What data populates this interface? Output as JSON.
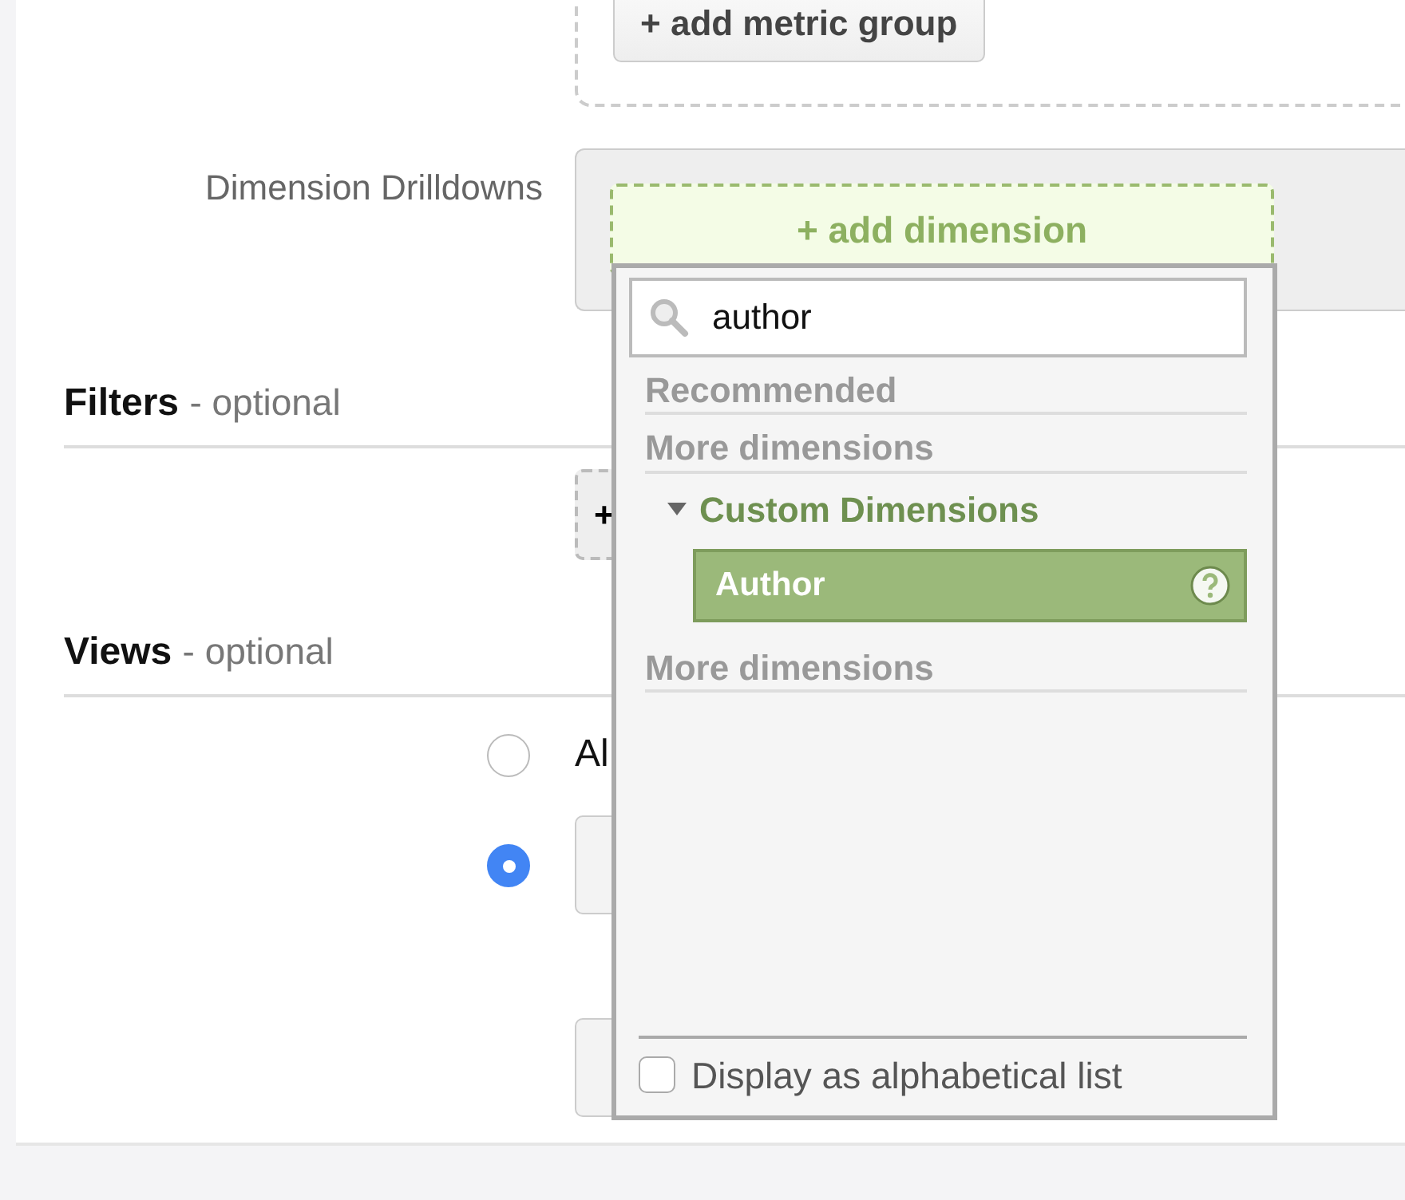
{
  "metrics": {
    "add_button": "+ add metric group"
  },
  "dimension_drilldowns": {
    "label": "Dimension Drilldowns",
    "add_button": "+ add dimension"
  },
  "filters": {
    "title": "Filters",
    "hint": "- optional",
    "add_button": "+"
  },
  "views": {
    "title": "Views",
    "hint": "- optional",
    "options": [
      {
        "label": "Al",
        "selected": false
      },
      {
        "selected": true
      }
    ]
  },
  "dropdown": {
    "search": {
      "value": "author"
    },
    "sections": [
      {
        "kind": "header",
        "label": "Recommended"
      },
      {
        "kind": "header",
        "label": "More dimensions"
      },
      {
        "kind": "group",
        "label": "Custom Dimensions",
        "expanded": true,
        "children": [
          {
            "label": "Author",
            "selected": true
          }
        ]
      },
      {
        "kind": "header",
        "label": "More dimensions"
      }
    ],
    "alphabetical": {
      "label": "Display as alphabetical list",
      "checked": false
    }
  }
}
